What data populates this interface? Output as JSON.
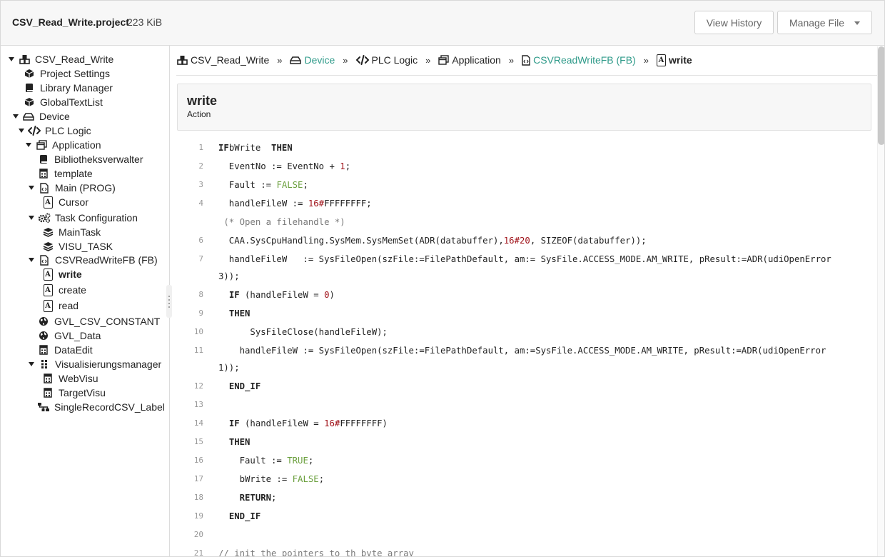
{
  "header": {
    "file_name": "CSV_Read_Write.project",
    "file_size": "223 KiB",
    "view_history": "View History",
    "manage_file": "Manage File"
  },
  "tree": [
    {
      "label": "CSV_Read_Write",
      "icon": "cubes-icon",
      "expand": true
    },
    {
      "label": "Project Settings",
      "icon": "cube-icon"
    },
    {
      "label": "Library Manager",
      "icon": "book-icon"
    },
    {
      "label": "GlobalTextList",
      "icon": "cube-icon"
    },
    {
      "label": "Device",
      "icon": "device-icon",
      "expand": true
    },
    {
      "label": "PLC Logic",
      "icon": "code-icon",
      "expand": true
    },
    {
      "label": "Application",
      "icon": "window-icon",
      "expand": true
    },
    {
      "label": "Bibliotheksverwalter",
      "icon": "book-icon"
    },
    {
      "label": "template",
      "icon": "calculator-icon"
    },
    {
      "label": "Main (PROG)",
      "icon": "file-code-icon",
      "expand": true
    },
    {
      "label": "Cursor",
      "icon": "action-a-icon"
    },
    {
      "label": "Task Configuration",
      "icon": "gears-icon",
      "expand": true
    },
    {
      "label": "MainTask",
      "icon": "layers-icon"
    },
    {
      "label": "VISU_TASK",
      "icon": "layers-icon"
    },
    {
      "label": "CSVReadWriteFB (FB)",
      "icon": "file-code-icon",
      "expand": true
    },
    {
      "label": "write",
      "icon": "action-a-icon",
      "bold": true
    },
    {
      "label": "create",
      "icon": "action-a-icon"
    },
    {
      "label": "read",
      "icon": "action-a-icon"
    },
    {
      "label": "GVL_CSV_CONSTANT",
      "icon": "globe-icon"
    },
    {
      "label": "GVL_Data",
      "icon": "globe-icon"
    },
    {
      "label": "DataEdit",
      "icon": "calculator-icon"
    },
    {
      "label": "Visualisierungsmanager",
      "icon": "grip-icon",
      "expand": true
    },
    {
      "label": "WebVisu",
      "icon": "calculator-icon"
    },
    {
      "label": "TargetVisu",
      "icon": "calculator-icon"
    },
    {
      "label": "SingleRecordCSV_Label",
      "icon": "sitemap-icon"
    }
  ],
  "breadcrumb": [
    {
      "label": "CSV_Read_Write",
      "icon": "cubes-icon",
      "link": false
    },
    {
      "label": "Device",
      "icon": "device-icon",
      "link": true
    },
    {
      "label": "PLC Logic",
      "icon": "code-icon",
      "link": false
    },
    {
      "label": "Application",
      "icon": "window-icon",
      "link": false
    },
    {
      "label": "CSVReadWriteFB (FB)",
      "icon": "file-code-icon",
      "link": true
    },
    {
      "label": "write",
      "icon": "action-a-icon",
      "link": false,
      "current": true
    }
  ],
  "breadcrumb_separator": "»",
  "title": {
    "name": "write",
    "kind": "Action"
  },
  "colors": {
    "link": "#2e9a89",
    "number": "#a0131a",
    "boolean": "#6a9f3c",
    "comment": "#7a7a7a"
  },
  "code_lines": [
    {
      "no": "1",
      "segs": [
        [
          "kw",
          "IF"
        ],
        [
          "",
          "bWrite  "
        ],
        [
          "kw",
          "THEN"
        ]
      ]
    },
    {
      "no": "2",
      "segs": [
        [
          "",
          "  EventNo := EventNo + "
        ],
        [
          "num",
          "1"
        ],
        [
          "",
          ";"
        ]
      ]
    },
    {
      "no": "3",
      "segs": [
        [
          "",
          "  Fault := "
        ],
        [
          "bool",
          "FALSE"
        ],
        [
          "",
          ";"
        ]
      ]
    },
    {
      "no": "4",
      "segs": [
        [
          "",
          "  handleFileW := "
        ],
        [
          "num",
          "16#"
        ],
        [
          "",
          "FFFFFFFF;"
        ]
      ]
    },
    {
      "no": "",
      "segs": [
        [
          "cmt",
          " (* Open a filehandle *)"
        ]
      ]
    },
    {
      "no": "6",
      "segs": [
        [
          "",
          "  CAA.SysCpuHandling.SysMem.SysMemSet(ADR(databuffer),"
        ],
        [
          "num",
          "16#20"
        ],
        [
          "",
          ", SIZEOF(databuffer));"
        ]
      ]
    },
    {
      "no": "7",
      "segs": [
        [
          "",
          "  handleFileW   := SysFileOpen(szFile:=FilePathDefault, am:= SysFile.ACCESS_MODE.AM_WRITE, pResult:=ADR(udiOpenError"
        ]
      ]
    },
    {
      "no": "",
      "segs": [
        [
          "",
          "3));"
        ]
      ]
    },
    {
      "no": "8",
      "segs": [
        [
          "",
          "  "
        ],
        [
          "kw",
          "IF"
        ],
        [
          "",
          " (handleFileW = "
        ],
        [
          "num",
          "0"
        ],
        [
          "",
          ")"
        ]
      ]
    },
    {
      "no": "9",
      "segs": [
        [
          "",
          "  "
        ],
        [
          "kw",
          "THEN"
        ]
      ]
    },
    {
      "no": "10",
      "segs": [
        [
          "",
          "      SysFileClose(handleFileW);"
        ]
      ]
    },
    {
      "no": "11",
      "segs": [
        [
          "",
          "    handleFileW := SysFileOpen(szFile:=FilePathDefault, am:=SysFile.ACCESS_MODE.AM_WRITE, pResult:=ADR(udiOpenError"
        ]
      ]
    },
    {
      "no": "",
      "segs": [
        [
          "",
          "1));"
        ]
      ]
    },
    {
      "no": "12",
      "segs": [
        [
          "",
          "  "
        ],
        [
          "kw",
          "END_IF"
        ]
      ]
    },
    {
      "no": "13",
      "segs": [
        [
          "",
          ""
        ]
      ]
    },
    {
      "no": "14",
      "segs": [
        [
          "",
          "  "
        ],
        [
          "kw",
          "IF"
        ],
        [
          "",
          " (handleFileW = "
        ],
        [
          "num",
          "16#"
        ],
        [
          "",
          "FFFFFFFF)"
        ]
      ]
    },
    {
      "no": "15",
      "segs": [
        [
          "",
          "  "
        ],
        [
          "kw",
          "THEN"
        ]
      ]
    },
    {
      "no": "16",
      "segs": [
        [
          "",
          "    Fault := "
        ],
        [
          "bool",
          "TRUE"
        ],
        [
          "",
          ";"
        ]
      ]
    },
    {
      "no": "17",
      "segs": [
        [
          "",
          "    bWrite := "
        ],
        [
          "bool",
          "FALSE"
        ],
        [
          "",
          ";"
        ]
      ]
    },
    {
      "no": "18",
      "segs": [
        [
          "",
          "    "
        ],
        [
          "kw",
          "RETURN"
        ],
        [
          "",
          ";"
        ]
      ]
    },
    {
      "no": "19",
      "segs": [
        [
          "",
          "  "
        ],
        [
          "kw",
          "END_IF"
        ]
      ]
    },
    {
      "no": "20",
      "segs": [
        [
          "",
          ""
        ]
      ]
    },
    {
      "no": "21",
      "segs": [
        [
          "cmt",
          "// init the pointers to th byte array"
        ]
      ]
    }
  ]
}
